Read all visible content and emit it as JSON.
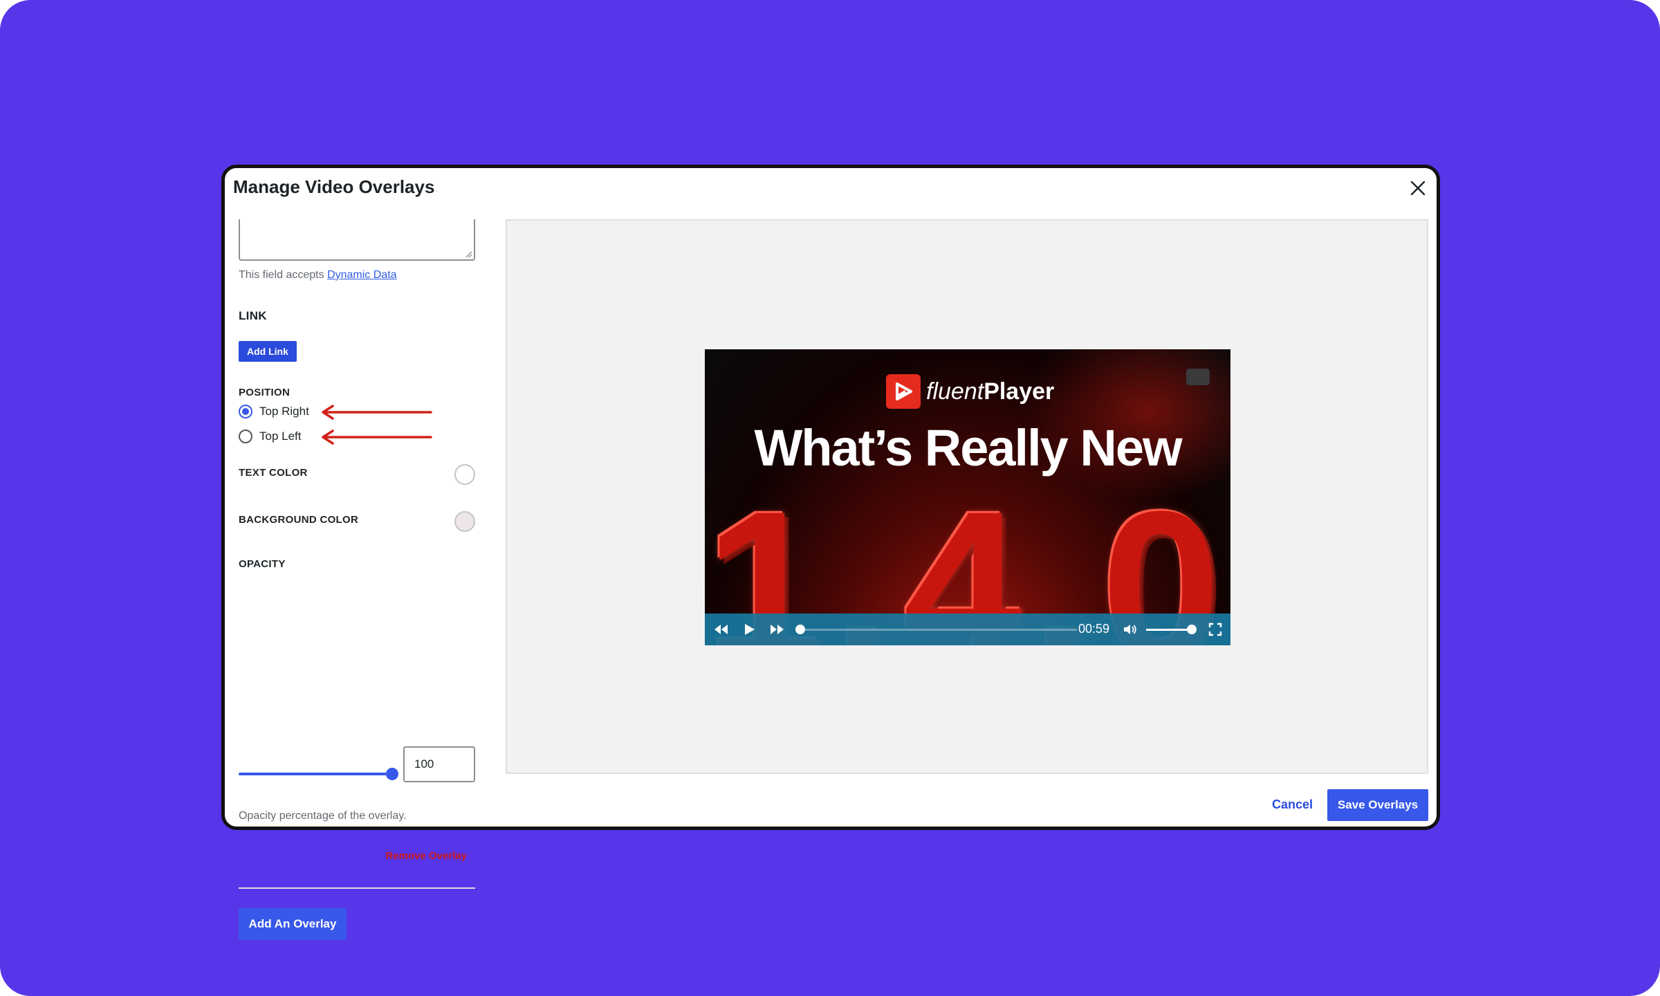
{
  "modal": {
    "title": "Manage Video Overlays"
  },
  "form": {
    "help_prefix": "This field accepts ",
    "help_link": "Dynamic Data",
    "link_label": "LINK",
    "add_link_button": "Add Link",
    "position_label": "POSITION",
    "position_options": [
      {
        "label": "Top Right",
        "checked": true
      },
      {
        "label": "Top Left",
        "checked": false
      }
    ],
    "text_color_label": "TEXT COLOR",
    "text_color_value": "#ffffff",
    "background_color_label": "BACKGROUND COLOR",
    "background_color_value": "#eee6e6",
    "opacity_label": "OPACITY",
    "opacity_value": "100",
    "opacity_help": "Opacity percentage of the overlay.",
    "remove_overlay": "Remove Overlay",
    "add_overlay_button": "Add An Overlay"
  },
  "video": {
    "brand_light": "fluent",
    "brand_bold": "Player",
    "headline": "What’s Really New",
    "version_text": "1.4.0",
    "time": "00:59",
    "progress": 0,
    "volume": 1.0
  },
  "footer": {
    "cancel": "Cancel",
    "save": "Save Overlays"
  },
  "colors": {
    "background": "#5735e8",
    "primary": "#3858e9",
    "danger": "#cc1818",
    "annotation_arrow": "#d0221a"
  }
}
